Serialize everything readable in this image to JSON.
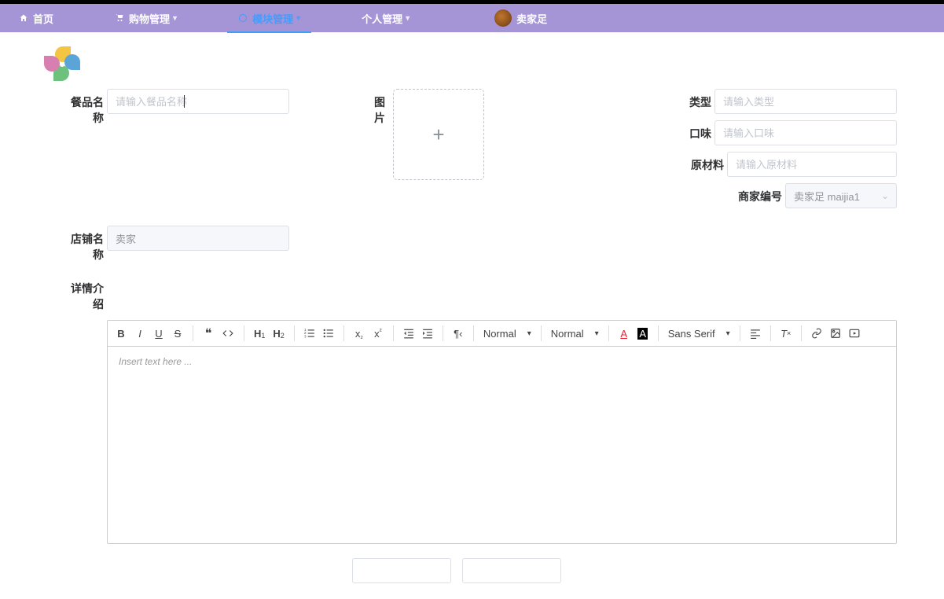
{
  "nav": {
    "home": "首页",
    "shopping": "购物管理",
    "module": "模块管理",
    "personal": "个人管理",
    "seller": "卖家足"
  },
  "form": {
    "name_label": "餐品名称",
    "name_placeholder": "请输入餐品名称",
    "image_label": "图片",
    "type_label": "类型",
    "type_placeholder": "请输入类型",
    "flavor_label": "口味",
    "flavor_placeholder": "请输入口味",
    "material_label": "原材料",
    "material_placeholder": "请输入原材料",
    "seller_id_label": "商家编号",
    "seller_id_value": "卖家足 maijia1",
    "shop_name_label": "店铺名称",
    "shop_name_value": "卖家",
    "detail_label": "详情介绍"
  },
  "editor": {
    "placeholder": "Insert text here ...",
    "size_select": "Normal",
    "header_select": "Normal",
    "font_select": "Sans Serif"
  },
  "toolbar": {
    "h1": "H₁",
    "h2": "H₂",
    "x1": "x₁",
    "x2": "x²"
  }
}
